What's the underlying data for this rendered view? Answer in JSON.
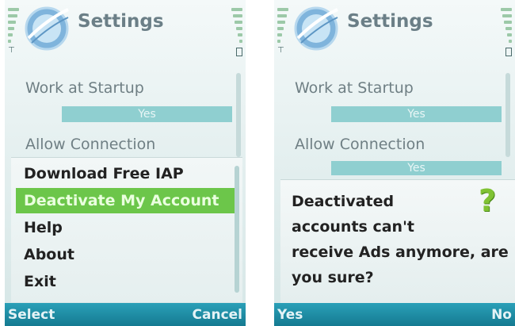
{
  "left": {
    "title": "Settings",
    "settings": [
      {
        "label": "Work at Startup",
        "value": "Yes"
      },
      {
        "label": "Allow Connection",
        "value": ""
      }
    ],
    "menu": [
      {
        "label": "Download Free IAP"
      },
      {
        "label": "Deactivate My Account",
        "selected": true
      },
      {
        "label": "Help"
      },
      {
        "label": "About"
      },
      {
        "label": "Exit"
      }
    ],
    "softkeys": {
      "left": "Select",
      "right": "Cancel"
    }
  },
  "right": {
    "title": "Settings",
    "settings": [
      {
        "label": "Work at Startup",
        "value": "Yes"
      },
      {
        "label": "Allow Connection",
        "value": "Yes"
      }
    ],
    "dialog": {
      "lines": [
        "Deactivated",
        "accounts can't",
        "receive Ads anymore, are",
        "you sure?"
      ],
      "icon": "question-mark-icon"
    },
    "softkeys": {
      "left": "Yes",
      "right": "No"
    }
  },
  "colors": {
    "accent_selected": "#6cc64a",
    "softkey_bar": "#1d8ea6",
    "value_bar": "#8fcfd0"
  }
}
